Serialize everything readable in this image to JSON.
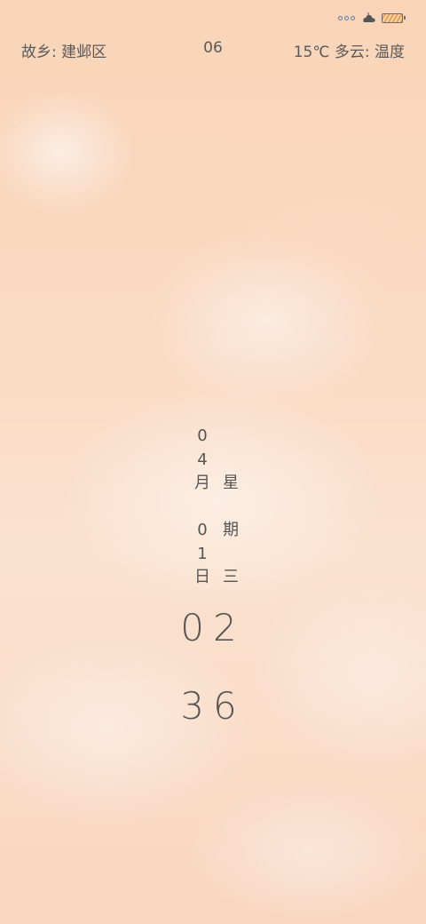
{
  "status_bar": {
    "signal_icon": "signal-dots-icon",
    "cloud_icon": "cloud-icon",
    "battery_icon": "battery-icon",
    "colors": {
      "signal": "#5b7fa6",
      "battery_fill": "#e9a04a"
    }
  },
  "header": {
    "hometown": "故乡: 建邺区",
    "center_number": "06",
    "weather": "15℃ 多云: 温度"
  },
  "date": {
    "month_col": [
      "0",
      "4",
      "月",
      "",
      "0",
      "1",
      "日"
    ],
    "weekday_col": [
      "",
      "",
      "星",
      "",
      "期",
      "",
      "三"
    ]
  },
  "time": {
    "hours": "02",
    "minutes": "36"
  },
  "colors": {
    "text": "#555555",
    "background_top": "#f9d4b8",
    "background_bottom": "#f8d6c0"
  }
}
